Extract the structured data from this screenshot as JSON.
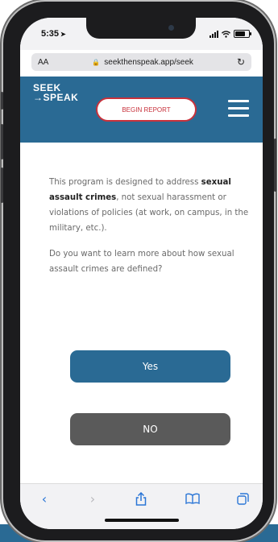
{
  "status": {
    "time": "5:35"
  },
  "browser": {
    "text_size_label": "AA",
    "url": "seekthenspeak.app/seek"
  },
  "header": {
    "logo_line1": "SEEK",
    "logo_line2": "→SPEAK",
    "begin_report_label": "BEGIN REPORT"
  },
  "content": {
    "para1_pre": "This program is designed to address ",
    "para1_bold": "sexual assault crimes",
    "para1_post": ", not sexual harassment or violations of policies (at work, on campus, in the military, etc.).",
    "para2": "Do you want to learn more about how sexual assault crimes are defined?"
  },
  "buttons": {
    "yes_label": "Yes",
    "no_label": "NO"
  },
  "colors": {
    "brand_blue": "#2a6a94",
    "accent_red": "#c8323c",
    "no_button_gray": "#5a5a5a"
  }
}
